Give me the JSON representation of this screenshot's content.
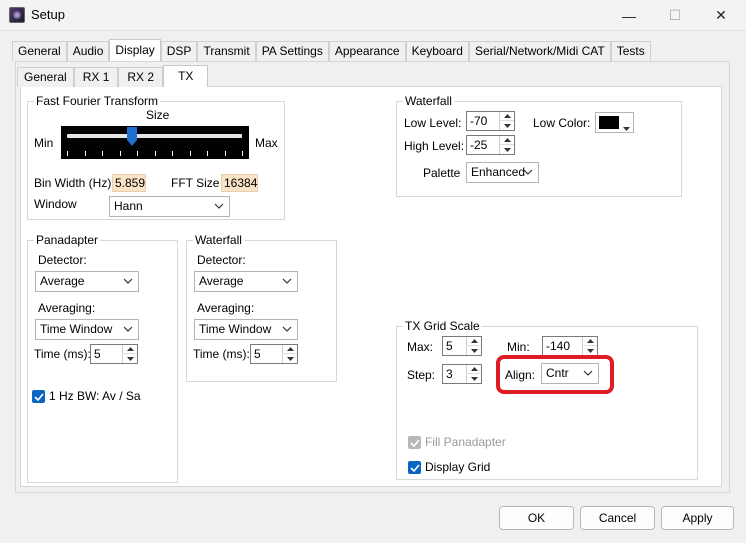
{
  "window": {
    "title": "Setup",
    "min_glyph": "—",
    "max_glyph": "☐",
    "close_glyph": "✕"
  },
  "main_tabs": [
    "General",
    "Audio",
    "Display",
    "DSP",
    "Transmit",
    "PA Settings",
    "Appearance",
    "Keyboard",
    "Serial/Network/Midi CAT",
    "Tests"
  ],
  "main_tab_active": "Display",
  "sub_tabs": [
    "General",
    "RX 1",
    "RX 2",
    "TX"
  ],
  "sub_tab_active": "TX",
  "fft": {
    "group_label": "Fast Fourier Transform",
    "size_label": "Size",
    "min_label": "Min",
    "max_label": "Max",
    "slider_value": 0.37,
    "bin_width_label": "Bin Width (Hz)",
    "bin_width_value": "5.859",
    "fft_size_label": "FFT Size",
    "fft_size_value": "16384",
    "window_label": "Window",
    "window_value": "Hann"
  },
  "waterfall_top": {
    "group_label": "Waterfall",
    "low_level_label": "Low Level:",
    "low_level_value": "-70",
    "high_level_label": "High Level:",
    "high_level_value": "-25",
    "low_color_label": "Low Color:",
    "low_color": "#000000",
    "palette_label": "Palette",
    "palette_value": "Enhanced"
  },
  "panadapter": {
    "group_label": "Panadapter",
    "detector_label": "Detector:",
    "detector_value": "Average",
    "averaging_label": "Averaging:",
    "averaging_value": "Time Window",
    "time_label": "Time (ms):",
    "time_value": "5",
    "bw_check_label": "1 Hz BW: Av / Sa",
    "bw_checked": true
  },
  "waterfall_mid": {
    "group_label": "Waterfall",
    "detector_label": "Detector:",
    "detector_value": "Average",
    "averaging_label": "Averaging:",
    "averaging_value": "Time Window",
    "time_label": "Time (ms):",
    "time_value": "5"
  },
  "tx_grid": {
    "group_label": "TX Grid Scale",
    "max_label": "Max:",
    "max_value": "5",
    "min_label": "Min:",
    "min_value": "-140",
    "step_label": "Step:",
    "step_value": "3",
    "align_label": "Align:",
    "align_value": "Cntr",
    "fill_label": "Fill Panadapter",
    "fill_checked": true,
    "fill_enabled": false,
    "grid_label": "Display Grid",
    "grid_checked": true
  },
  "buttons": {
    "ok": "OK",
    "cancel": "Cancel",
    "apply": "Apply"
  },
  "colors": {
    "highlight": "#e01b24",
    "checkbox": "#0a64c2",
    "slider_thumb": "#1e6fd0",
    "readout_bg": "#fbe3c6"
  }
}
